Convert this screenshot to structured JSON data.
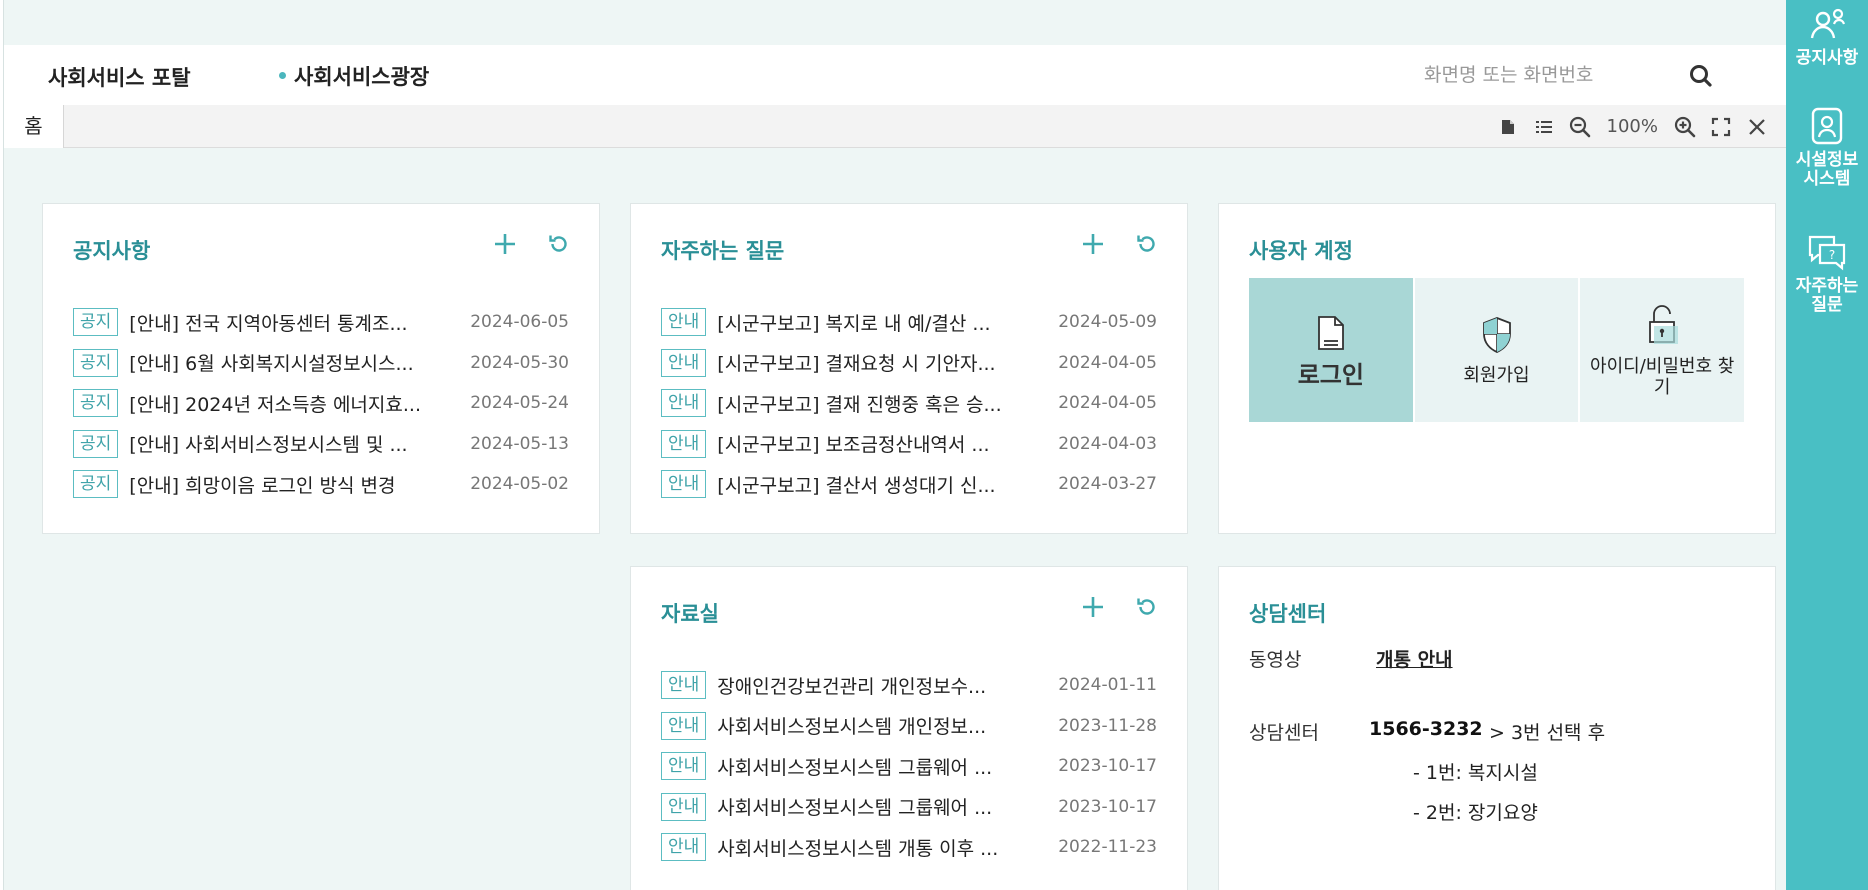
{
  "header": {
    "portal_title": "사회서비스 포탈",
    "nav_item": "사회서비스광장",
    "search_placeholder": "화면명 또는 화면번호"
  },
  "tabbar": {
    "home_tab": "홈",
    "zoom_level": "100%"
  },
  "notice": {
    "title": "공지사항",
    "items": [
      {
        "badge": "공지",
        "title": "[안내] 전국 지역아동센터 통계조...",
        "date": "2024-06-05"
      },
      {
        "badge": "공지",
        "title": "[안내] 6월 사회복지시설정보시스...",
        "date": "2024-05-30"
      },
      {
        "badge": "공지",
        "title": "[안내] 2024년 저소득층 에너지효...",
        "date": "2024-05-24"
      },
      {
        "badge": "공지",
        "title": "[안내] 사회서비스정보시스템 및 ...",
        "date": "2024-05-13"
      },
      {
        "badge": "공지",
        "title": "[안내] 희망이음 로그인 방식 변경",
        "date": "2024-05-02"
      }
    ]
  },
  "faq": {
    "title": "자주하는 질문",
    "items": [
      {
        "badge": "안내",
        "title": "[시군구보고] 복지로 내 예/결산 ...",
        "date": "2024-05-09"
      },
      {
        "badge": "안내",
        "title": "[시군구보고] 결재요청 시 기안자...",
        "date": "2024-04-05"
      },
      {
        "badge": "안내",
        "title": "[시군구보고] 결재 진행중 혹은 승...",
        "date": "2024-04-05"
      },
      {
        "badge": "안내",
        "title": "[시군구보고] 보조금정산내역서 ...",
        "date": "2024-04-03"
      },
      {
        "badge": "안내",
        "title": "[시군구보고] 결산서 생성대기 신...",
        "date": "2024-03-27"
      }
    ]
  },
  "archive": {
    "title": "자료실",
    "items": [
      {
        "badge": "안내",
        "title": "장애인건강보건관리 개인정보수...",
        "date": "2024-01-11"
      },
      {
        "badge": "안내",
        "title": "사회서비스정보시스템 개인정보...",
        "date": "2023-11-28"
      },
      {
        "badge": "안내",
        "title": "사회서비스정보시스템 그룹웨어 ...",
        "date": "2023-10-17"
      },
      {
        "badge": "안내",
        "title": "사회서비스정보시스템 그룹웨어 ...",
        "date": "2023-10-17"
      },
      {
        "badge": "안내",
        "title": "사회서비스정보시스템 개통 이후 ...",
        "date": "2022-11-23"
      }
    ]
  },
  "account": {
    "title": "사용자 계정",
    "login": "로그인",
    "signup": "회원가입",
    "find": "아이디/비밀번호 찾기"
  },
  "counsel": {
    "title": "상담센터",
    "video_label": "동영상",
    "video_link": "개통 안내",
    "center_label": "상담센터",
    "phone": "1566-3232",
    "select_text": "> 3번 선택 후",
    "option1": "- 1번: 복지시설",
    "option2": "- 2번: 장기요양"
  },
  "rail": {
    "notice": "공지사항",
    "facility": "시설정보 시스템",
    "faq": "자주하는 질문"
  },
  "colors": {
    "accent": "#2a8f96",
    "rail": "#49bfc4",
    "login_bg": "#a9d7d6"
  }
}
